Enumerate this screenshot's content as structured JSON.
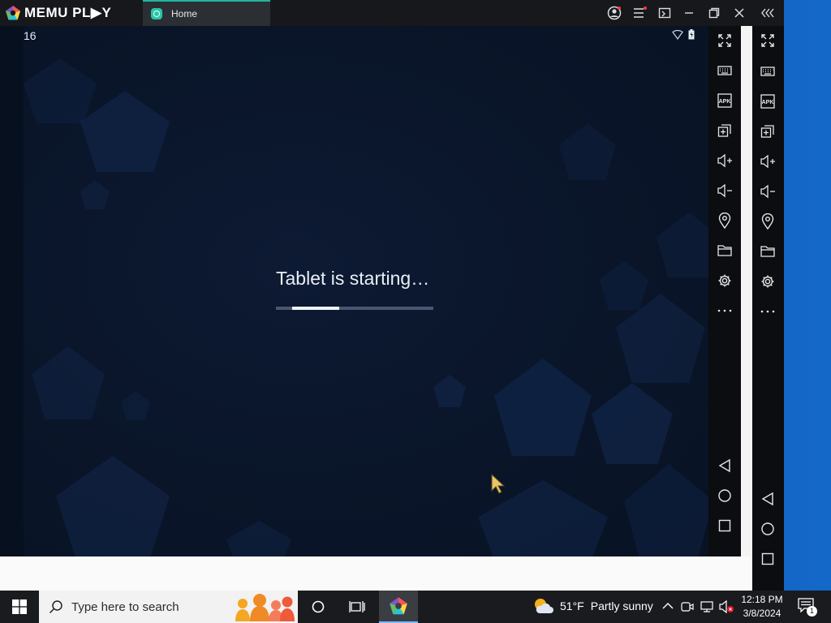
{
  "window": {
    "brand": "MEMU PL▶Y",
    "tab_label": "Home",
    "titlebar_icons": [
      "account-icon",
      "menu-icon",
      "multi-window-icon",
      "minimize-icon",
      "restore-icon",
      "close-icon",
      "collapse-sidebar-icon"
    ]
  },
  "android": {
    "status_time": "16",
    "status_icons": [
      "wifi-icon",
      "battery-icon"
    ],
    "loading_text": "Tablet is starting…",
    "progress_fraction": 0.3
  },
  "sidebar": {
    "icons": [
      "fullscreen-icon",
      "keyboard-icon",
      "apk-icon",
      "add-window-icon",
      "volume-up-icon",
      "volume-down-icon",
      "location-icon",
      "folder-icon",
      "settings-icon",
      "more-icon"
    ],
    "apk_label": "APK",
    "nav_icons": [
      "back-icon",
      "home-icon",
      "recents-icon"
    ]
  },
  "taskbar": {
    "search_placeholder": "Type here to search",
    "weather_temp": "51°F",
    "weather_desc": "Partly sunny",
    "time": "12:18 PM",
    "date": "3/8/2024",
    "notification_count": "1"
  },
  "colors": {
    "screen_bg": "#0a1529",
    "accent": "#1fb5a0",
    "taskbar": "#191b1f"
  }
}
